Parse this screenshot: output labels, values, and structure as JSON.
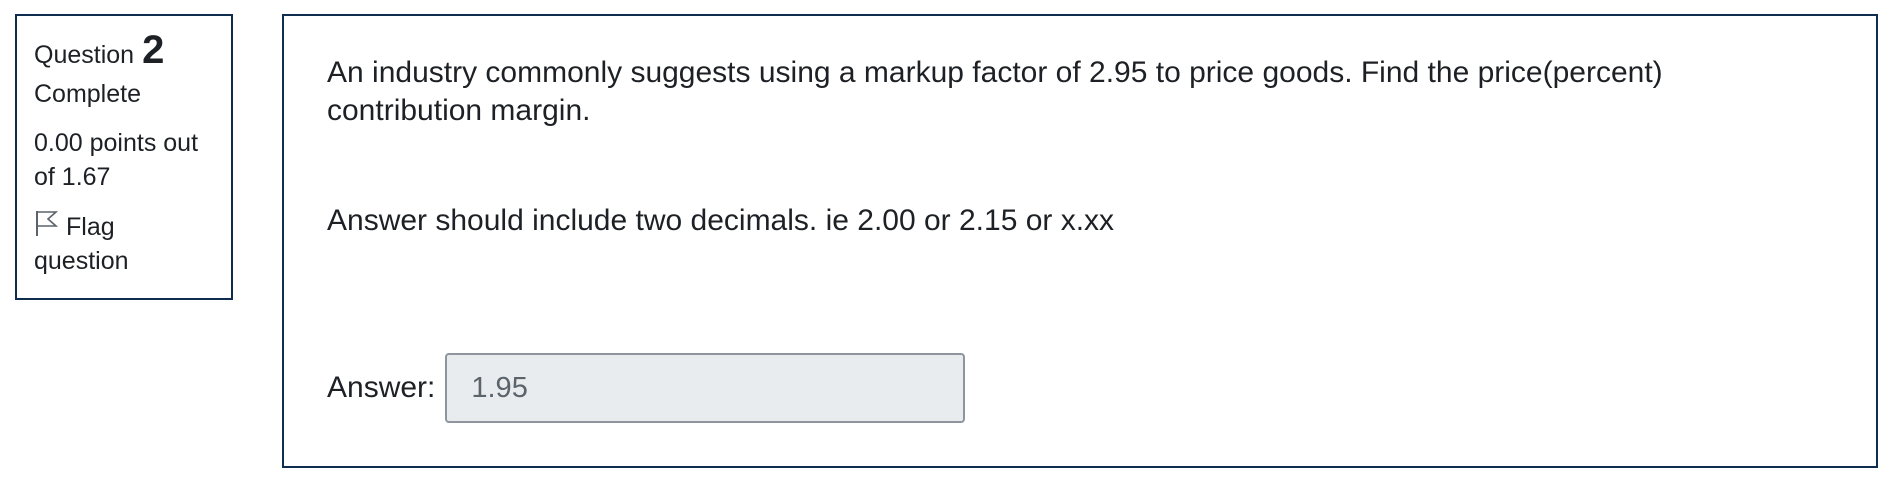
{
  "info": {
    "question_label": "Question",
    "question_number": "2",
    "state": "Complete",
    "grade": "0.00 points out of 1.67",
    "flag_icon": "flag-outline-icon",
    "flag_label": "Flag question"
  },
  "question": {
    "text": "An industry commonly suggests using a markup factor of 2.95 to price goods. Find the price(percent) contribution margin.",
    "instruction": "Answer should include two decimals. ie 2.00 or 2.15 or x.xx"
  },
  "answer": {
    "label": "Answer:",
    "value": "1.95"
  },
  "colors": {
    "border": "#0f2d4f",
    "input_bg": "#e9ecef",
    "input_border": "#8f959e",
    "text": "#1d2125"
  }
}
